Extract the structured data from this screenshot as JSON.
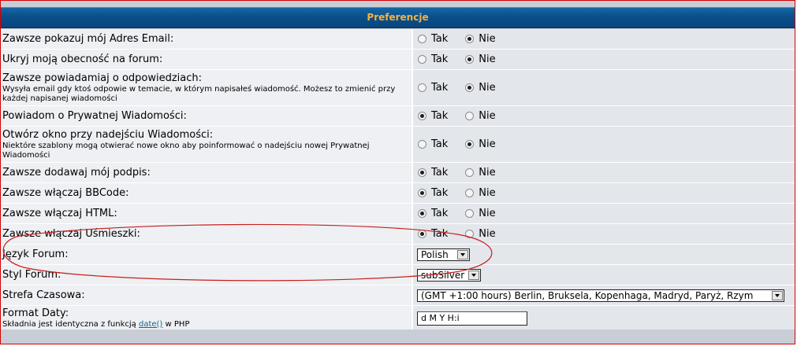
{
  "header": {
    "title": "Preferencje"
  },
  "yes_no": {
    "yes": "Tak",
    "no": "Nie"
  },
  "rows": [
    {
      "label": "Zawsze pokazuj mój Adres Email:",
      "value": "no"
    },
    {
      "label": "Ukryj moją obecność na forum:",
      "value": "no"
    },
    {
      "label": "Zawsze powiadamiaj o odpowiedziach:",
      "desc": "Wysyła email gdy ktoś odpowie w temacie, w którym napisałeś wiadomość. Możesz to zmienić przy każdej napisanej wiadomości",
      "value": "no"
    },
    {
      "label": "Powiadom o Prywatnej Wiadomości:",
      "value": "yes"
    },
    {
      "label": "Otwórz okno przy nadejściu Wiadomości:",
      "desc": "Niektóre szablony mogą otwierać nowe okno aby poinformować o nadejściu nowej Prywatnej Wiadomości",
      "value": "no"
    },
    {
      "label": "Zawsze dodawaj mój podpis:",
      "value": "yes"
    },
    {
      "label": "Zawsze włączaj BBCode:",
      "value": "yes"
    },
    {
      "label": "Zawsze włączaj HTML:",
      "value": "yes"
    },
    {
      "label": "Zawsze włączaj Uśmieszki:",
      "value": "yes"
    }
  ],
  "language": {
    "label": "Język Forum:",
    "value": "Polish"
  },
  "style": {
    "label": "Styl Forum:",
    "value": "subSilver"
  },
  "timezone": {
    "label": "Strefa Czasowa:",
    "value": "(GMT +1:00 hours) Berlin, Bruksela, Kopenhaga, Madryd, Paryż, Rzym"
  },
  "date_format": {
    "label": "Format Daty:",
    "desc_prefix": "Składnia jest identyczna z funkcją",
    "desc_link": "date()",
    "desc_suffix": "w PHP",
    "value": "d M Y H:i"
  },
  "colors": {
    "header_bg": "#0b4f88",
    "header_text": "#f7b13d",
    "annotation": "#c81e1e"
  }
}
